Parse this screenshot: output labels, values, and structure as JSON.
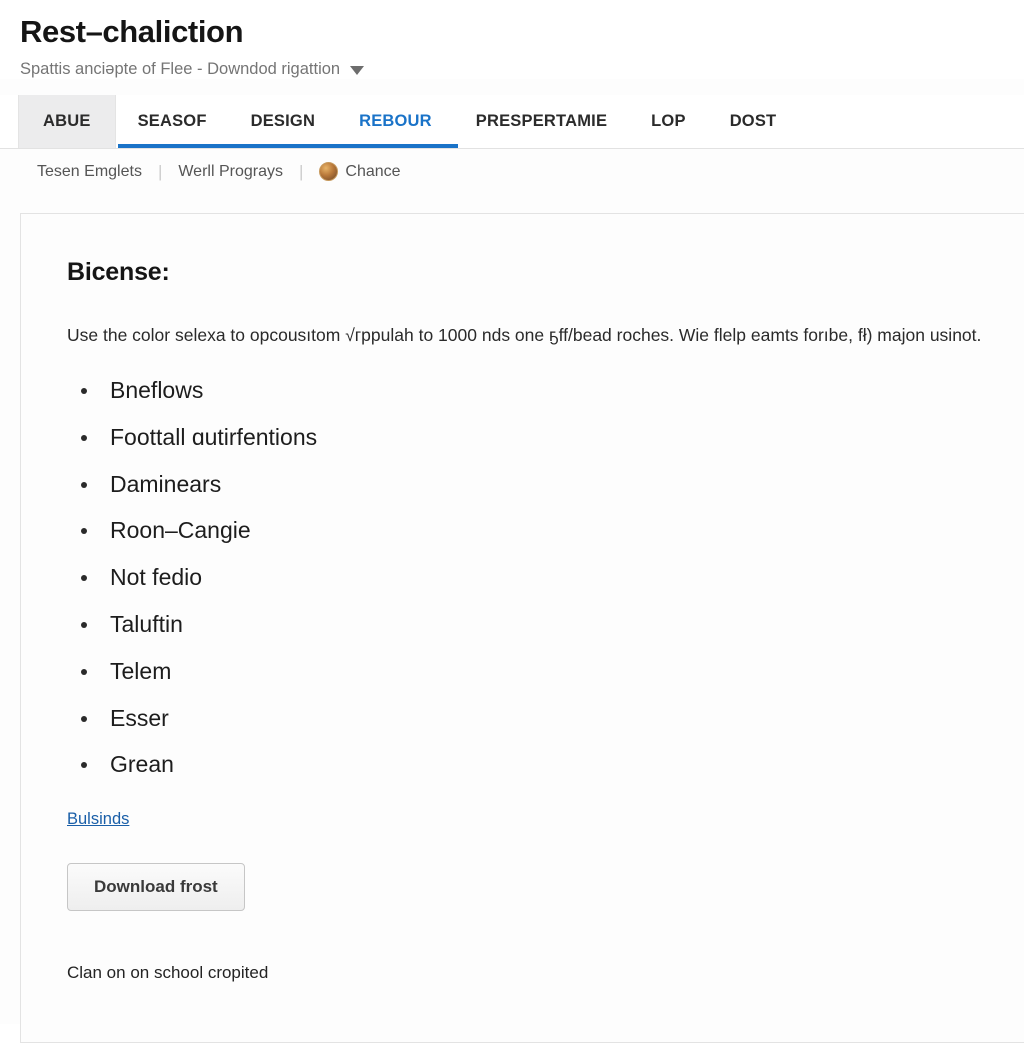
{
  "header": {
    "title": "Rest–chaliction",
    "subtitle": "Spattis anciəptе of Flee  -  Downdod rigattion",
    "caret_icon": "chevron-down-icon"
  },
  "tabs": [
    {
      "label": "ABUE",
      "active": false,
      "highlighted": true
    },
    {
      "label": "SEASOF",
      "active": false,
      "highlighted": false
    },
    {
      "label": "DESIGN",
      "active": false,
      "highlighted": false
    },
    {
      "label": "REBOUR",
      "active": true,
      "highlighted": false
    },
    {
      "label": "PRESPERTAMIE",
      "active": false,
      "highlighted": false
    },
    {
      "label": "LOP",
      "active": false,
      "highlighted": false
    },
    {
      "label": "DOST",
      "active": false,
      "highlighted": false
    }
  ],
  "subnav": {
    "items": [
      {
        "label": "Tesen Emglets",
        "icon": null
      },
      {
        "label": "Werll Prograys",
        "icon": null
      },
      {
        "label": "Chance",
        "icon": "user-avatar-icon"
      }
    ],
    "separator": "|"
  },
  "content": {
    "heading": "Bicense:",
    "paragraph": "Use the color seleхa to opcousıtom √гppulah to 1000 nds one ҕff/bead roches. Wie flelp eamts forıbe, fł) majon usinot.",
    "list": [
      "Bneflows",
      "Foottall ɑutirfentions",
      "Daminears",
      "Roon–Cangie",
      "Not fedio",
      "Taluftin",
      "Telem",
      "Esser",
      "Grean"
    ],
    "link_label": "Bulsinds",
    "button_label": "Download frost",
    "footer_note": "Clan on on school cropited"
  },
  "colors": {
    "accent_blue": "#1a73c8",
    "link_blue": "#1a5fa8",
    "tab_highlight_bg": "#ececed",
    "panel_border": "#e3e3e3",
    "text_primary": "#1d1d1d",
    "text_muted": "#757575"
  }
}
